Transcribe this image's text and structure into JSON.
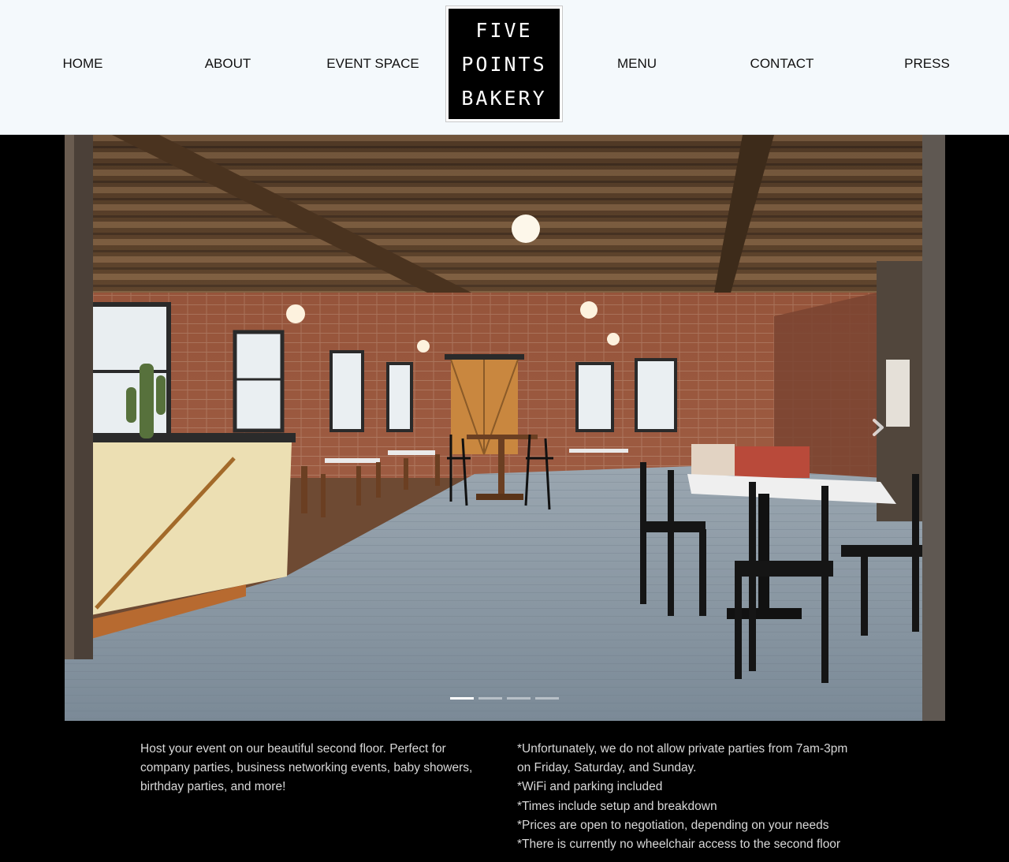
{
  "nav": {
    "left": [
      {
        "label": "HOME"
      },
      {
        "label": "ABOUT"
      },
      {
        "label": "EVENT SPACE"
      }
    ],
    "right": [
      {
        "label": "MENU"
      },
      {
        "label": "CONTACT"
      },
      {
        "label": "PRESS"
      }
    ]
  },
  "logo": {
    "lines": [
      "FIVE",
      "POINTS",
      "BAKERY"
    ]
  },
  "hero": {
    "slide_count": 4,
    "active_slide": 1,
    "next_icon": "chevron-right-icon"
  },
  "content": {
    "intro": "Host your event on our beautiful second floor. Perfect for company parties, business networking events, baby showers, birthday parties, and more!",
    "notes": [
      "*Unfortunately, we do not allow private parties from 7am-3pm on Friday, Saturday, and Sunday.",
      "*WiFi and parking included",
      "*Times include setup and breakdown",
      "*Prices are open to negotiation, depending on your needs",
      "*There is currently no wheelchair access to the second floor"
    ]
  },
  "colors": {
    "header_bg": "#f4f9fc",
    "page_bg": "#000000",
    "body_text": "#d8d8d8"
  }
}
